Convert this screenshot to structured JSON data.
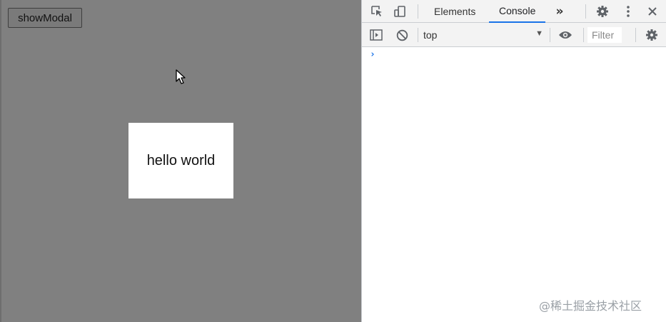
{
  "page": {
    "button_label": "showModal",
    "modal_text": "hello world"
  },
  "devtools": {
    "tabs": [
      "Elements",
      "Console"
    ],
    "active_tab": "Console",
    "context": "top",
    "filter_placeholder": "Filter",
    "prompt": "›",
    "watermark": "@稀土掘金技术社区"
  },
  "colors": {
    "overlay": "#808080",
    "accent": "#1a73e8"
  },
  "icons": [
    "inspect-element-icon",
    "device-toolbar-icon",
    "more-tabs-icon",
    "settings-icon",
    "kebab-menu-icon",
    "close-icon",
    "sidebar-toggle-icon",
    "clear-console-icon",
    "dropdown-arrow-icon",
    "eye-icon",
    "console-settings-icon"
  ]
}
